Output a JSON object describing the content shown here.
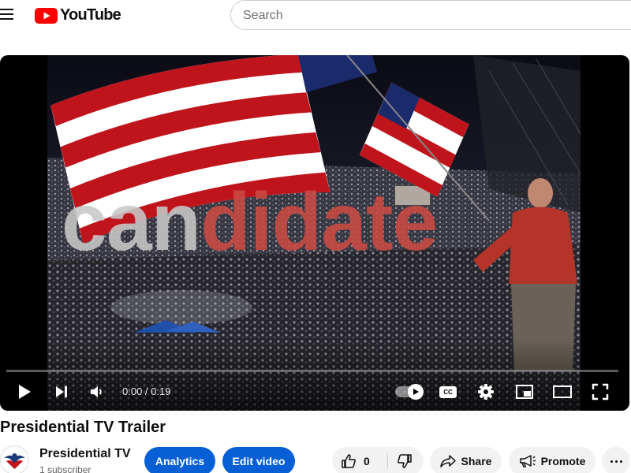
{
  "header": {
    "logo_text": "YouTube",
    "search_placeholder": "Search",
    "search_value": ""
  },
  "player": {
    "overlay_text_grey": "can",
    "overlay_text_red": "didate",
    "current_time": "0:00",
    "duration": "0:19",
    "time_display": "0:00 / 0:19",
    "progress": 0,
    "autoplay_on": true,
    "icons": [
      "play-icon",
      "next-icon",
      "volume-icon",
      "autoplay-toggle-icon",
      "subtitles-icon",
      "settings-icon",
      "miniplayer-icon",
      "theater-mode-icon",
      "fullscreen-icon"
    ]
  },
  "video": {
    "title": "Presidential TV Trailer"
  },
  "channel": {
    "name": "Presidential TV",
    "subscribers": "1 subscriber"
  },
  "actions": {
    "analytics_label": "Analytics",
    "edit_video_label": "Edit video",
    "like_count": "0",
    "share_label": "Share",
    "promote_label": "Promote"
  },
  "colors": {
    "brand_red": "#ff0000",
    "action_blue": "#065fd4",
    "pill_grey": "#f2f2f2",
    "overlay_grey": "#c8c8c8",
    "overlay_red": "#cc4a43"
  }
}
